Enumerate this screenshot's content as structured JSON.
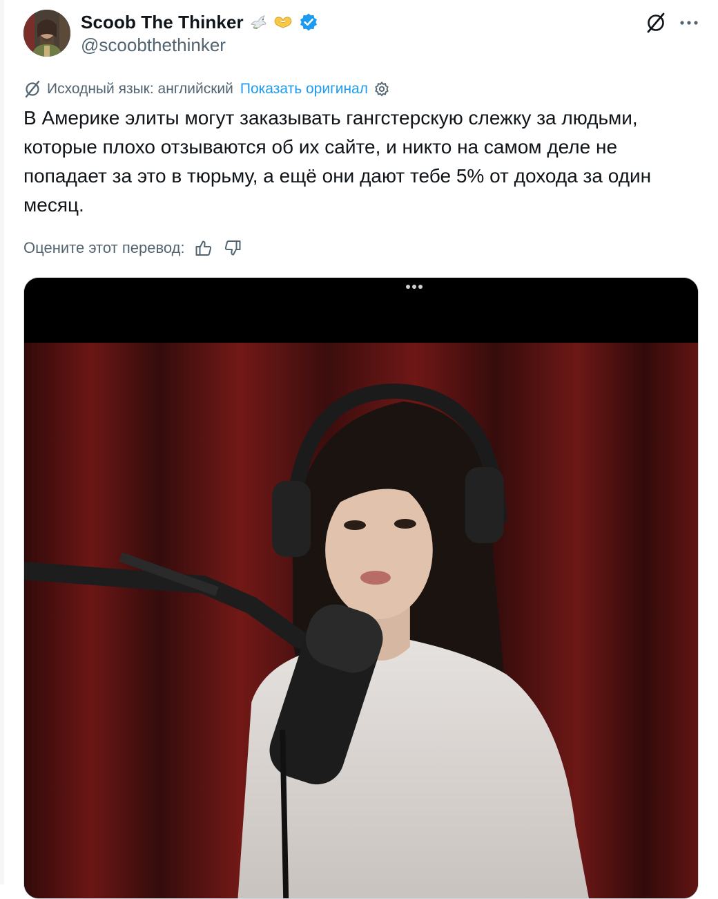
{
  "author": {
    "display_name": "Scoob The Thinker",
    "handle": "@scoobthethinker",
    "name_emojis": [
      "dove-emoji",
      "heart-hands-emoji"
    ],
    "verified": true
  },
  "header_actions": {
    "grok_icon": "grok-icon",
    "more_icon": "more-icon"
  },
  "translation": {
    "source_label": "Исходный язык: английский",
    "show_original": "Показать оригинал",
    "settings_icon": "gear-icon"
  },
  "tweet": {
    "text": "В Америке элиты могут заказывать гангстерскую слежку за людьми, которые плохо отзываются об их сайте, и никто на самом деле не попадает за это в тюрьму, а ещё они дают тебе 5% от дохода за один месяц."
  },
  "rate": {
    "label": "Оцените этот перевод:",
    "up_icon": "thumbs-up-icon",
    "down_icon": "thumbs-down-icon"
  },
  "media": {
    "kind": "video",
    "menu_icon": "more-dots-icon"
  },
  "colors": {
    "text": "#0f1419",
    "secondary": "#536471",
    "link": "#1d9bf0",
    "verified": "#1d9bf0"
  }
}
